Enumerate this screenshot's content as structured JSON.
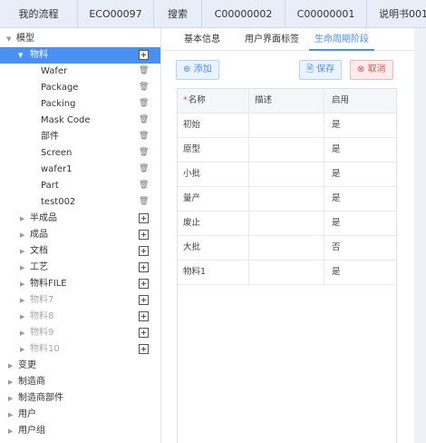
{
  "tabs": [
    {
      "label": "我的流程"
    },
    {
      "label": "ECO00097"
    },
    {
      "label": "搜索"
    },
    {
      "label": "C00000002"
    },
    {
      "label": "C00000001"
    },
    {
      "label": "说明书001"
    }
  ],
  "tree": {
    "root": "模型",
    "selected": "物料",
    "children_of_selected": [
      "Wafer",
      "Package",
      "Packing",
      "Mask Code",
      "部件",
      "Screen",
      "wafer1",
      "Part",
      "test002"
    ],
    "siblings": [
      {
        "label": "半成品"
      },
      {
        "label": "成品"
      },
      {
        "label": "文档"
      },
      {
        "label": "工艺"
      },
      {
        "label": "物料FILE"
      },
      {
        "label": "物料7"
      },
      {
        "label": "物料8"
      },
      {
        "label": "物料9"
      },
      {
        "label": "物料10"
      }
    ],
    "top_level": [
      "变更",
      "制造商",
      "制造商部件",
      "用户",
      "用户组"
    ]
  },
  "subtabs": [
    "基本信息",
    "用户界面标签",
    "生命周期阶段"
  ],
  "active_subtab": "生命周期阶段",
  "toolbar": {
    "add": "添加",
    "save": "保存",
    "cancel": "取消"
  },
  "table": {
    "required_mark": "*",
    "headers": [
      "名称",
      "描述",
      "启用"
    ],
    "rows": [
      {
        "name": "初始",
        "desc": "",
        "enabled": "是"
      },
      {
        "name": "原型",
        "desc": "",
        "enabled": "是"
      },
      {
        "name": "小批",
        "desc": "",
        "enabled": "是"
      },
      {
        "name": "量产",
        "desc": "",
        "enabled": "是"
      },
      {
        "name": "废止",
        "desc": "",
        "enabled": "是"
      },
      {
        "name": "大批",
        "desc": "",
        "enabled": "否"
      },
      {
        "name": "物料1",
        "desc": "",
        "enabled": "是"
      }
    ]
  },
  "colors": {
    "accent": "#4a90f0",
    "danger": "#e05555",
    "tabbar_bg": "#e8eef7"
  }
}
